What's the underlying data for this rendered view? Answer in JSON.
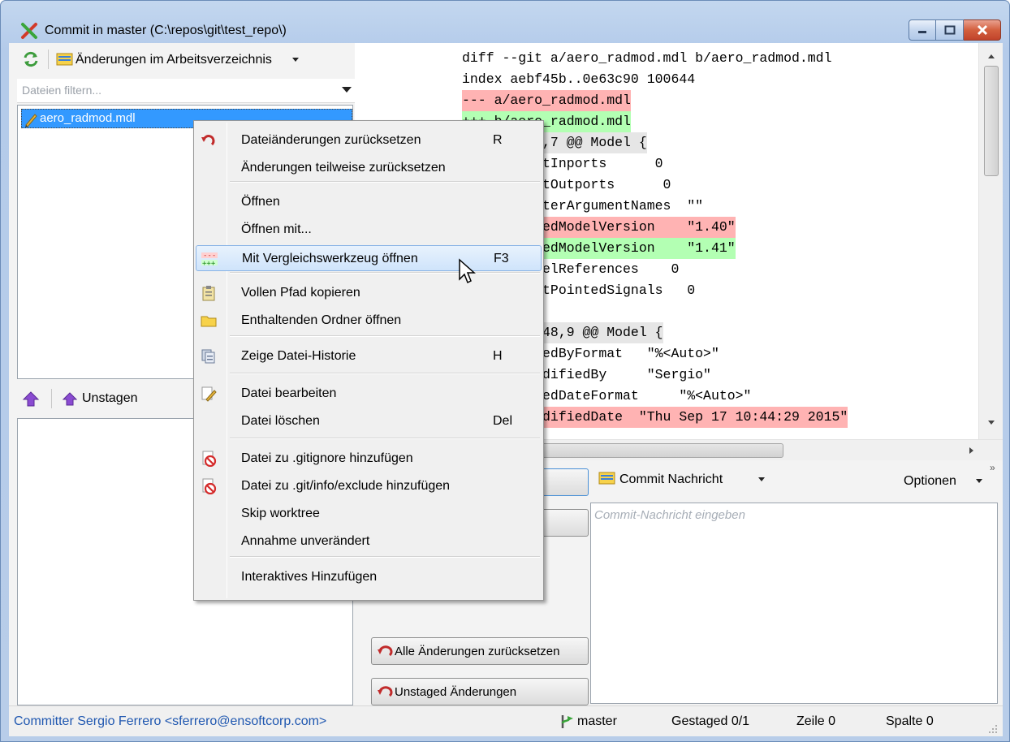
{
  "window": {
    "title": "Commit in master (C:\\repos\\git\\test_repo\\)"
  },
  "left": {
    "workdir_label": "Änderungen im Arbeitsverzeichnis",
    "filter_placeholder": "Dateien filtern...",
    "files": [
      "aero_radmod.mdl"
    ],
    "unstage_label": "Unstagen"
  },
  "diff": {
    "lines": [
      {
        "text": "diff --git a/aero_radmod.mdl b/aero_radmod.mdl",
        "type": "header"
      },
      {
        "text": "index aebf45b..0e63c90 100644",
        "type": "header"
      },
      {
        "text": "--- a/aero_radmod.mdl",
        "type": "removed"
      },
      {
        "text": "+++ b/aero_radmod.mdl",
        "type": "added"
      },
      {
        "text": "@@ -7,7 +7,7 @@ Model {",
        "type": "hunk"
      },
      {
        "text": "    NumRootInports      0",
        "type": "context"
      },
      {
        "text": "    NumRootOutports      0",
        "type": "context"
      },
      {
        "text": "    ParameterArgumentNames  \"\"",
        "type": "context"
      },
      {
        "text": "-   ComputedModelVersion    \"1.40\"",
        "type": "removed"
      },
      {
        "text": "+   ComputedModelVersion    \"1.41\"",
        "type": "added"
      },
      {
        "text": "    NumModelReferences    0",
        "type": "context"
      },
      {
        "text": "    NumTestPointedSignals   0",
        "type": "context"
      },
      {
        "text": "",
        "type": "context"
      },
      {
        "text": "@@ -48,9 +48,9 @@ Model {",
        "type": "hunk"
      },
      {
        "text": "    ModifiedByFormat   \"%<Auto>\"",
        "type": "context"
      },
      {
        "text": "    LastModifiedBy     \"Sergio\"",
        "type": "context"
      },
      {
        "text": "    ModifiedDateFormat     \"%<Auto>\"",
        "type": "context"
      },
      {
        "text": "-   LastModifiedDate  \"Thu Sep 17 10:44:29 2015\"",
        "type": "removed"
      }
    ]
  },
  "buttons": {
    "reset_all": "Alle Änderungen zurücksetzen",
    "unstaged": "Unstaged Änderungen"
  },
  "commit": {
    "message_label": "Commit Nachricht",
    "options_label": "Optionen",
    "message_placeholder": "Commit-Nachricht eingeben"
  },
  "context_menu": {
    "items": [
      {
        "label": "Dateiänderungen zurücksetzen",
        "shortcut": "R",
        "icon": "revert-icon"
      },
      {
        "label": "Änderungen teilweise zurücksetzen",
        "shortcut": "",
        "icon": ""
      },
      {
        "label": "Öffnen",
        "shortcut": "",
        "icon": ""
      },
      {
        "label": "Öffnen mit...",
        "shortcut": "",
        "icon": ""
      },
      {
        "label": "Mit Vergleichswerkzeug öffnen",
        "shortcut": "F3",
        "icon": "diff-tool-icon"
      },
      {
        "label": "Vollen Pfad kopieren",
        "shortcut": "",
        "icon": "clipboard-icon"
      },
      {
        "label": "Enthaltenden Ordner öffnen",
        "shortcut": "",
        "icon": "folder-icon"
      },
      {
        "label": "Zeige Datei-Historie",
        "shortcut": "H",
        "icon": "history-icon"
      },
      {
        "label": "Datei bearbeiten",
        "shortcut": "",
        "icon": "edit-icon"
      },
      {
        "label": "Datei löschen",
        "shortcut": "Del",
        "icon": ""
      },
      {
        "label": "Datei zu .gitignore hinzufügen",
        "shortcut": "",
        "icon": "ignore-icon"
      },
      {
        "label": "Datei zu .git/info/exclude hinzufügen",
        "shortcut": "",
        "icon": "ignore-icon"
      },
      {
        "label": "Skip worktree",
        "shortcut": "",
        "icon": ""
      },
      {
        "label": "Annahme unverändert",
        "shortcut": "",
        "icon": ""
      },
      {
        "label": "Interaktives Hinzufügen",
        "shortcut": "",
        "icon": ""
      }
    ]
  },
  "status": {
    "committer": "Committer Sergio Ferrero <sferrero@ensoftcorp.com>",
    "branch": "master",
    "staged": "Gestaged 0/1",
    "line": "Zeile 0",
    "column": "Spalte 0"
  },
  "colors": {
    "removed_bg": "#ffb3b3",
    "added_bg": "#b3ffb3",
    "hunk_bg": "#e6e6e6",
    "selection": "#3399ff"
  }
}
